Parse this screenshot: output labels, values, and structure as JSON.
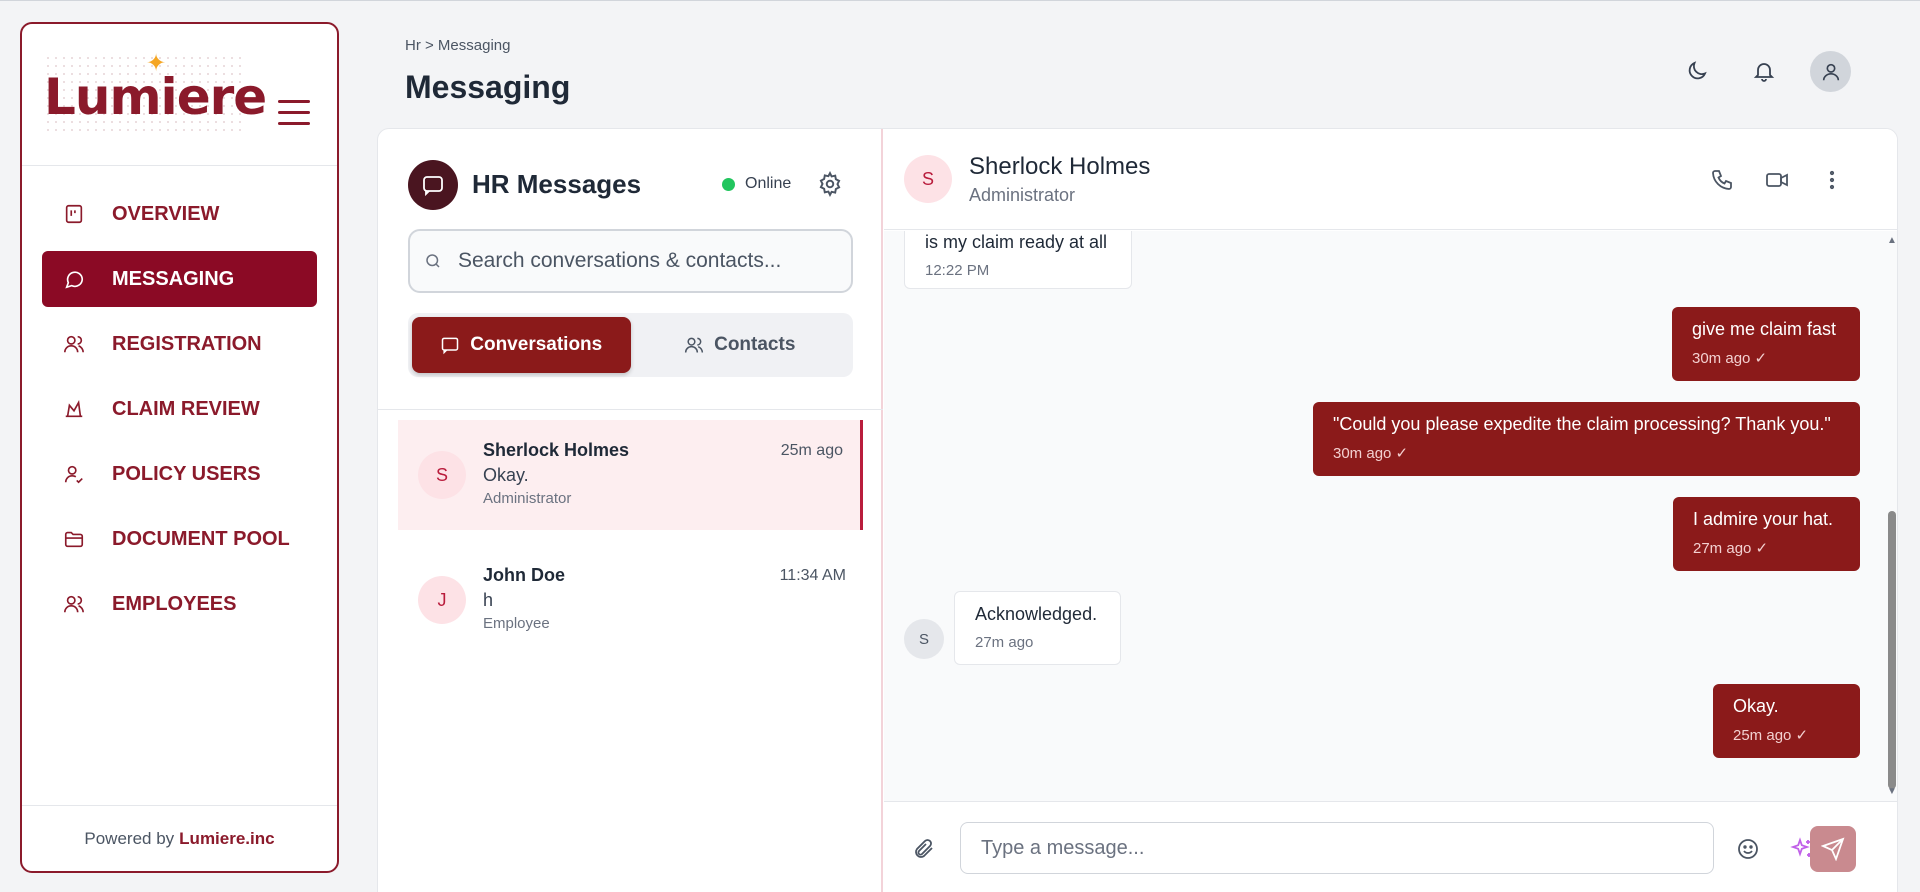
{
  "brand": {
    "name": "Lumiere",
    "powered_prefix": "Powered by",
    "powered_name": "Lumiere.inc",
    "color": "#8b1a2b"
  },
  "sidebar": {
    "items": [
      {
        "label": "OVERVIEW",
        "icon": "overview-icon",
        "active": false
      },
      {
        "label": "MESSAGING",
        "icon": "message-icon",
        "active": true
      },
      {
        "label": "REGISTRATION",
        "icon": "users-icon",
        "active": false
      },
      {
        "label": "CLAIM REVIEW",
        "icon": "claim-icon",
        "active": false
      },
      {
        "label": "POLICY USERS",
        "icon": "user-check-icon",
        "active": false
      },
      {
        "label": "DOCUMENT POOL",
        "icon": "folder-icon",
        "active": false
      },
      {
        "label": "EMPLOYEES",
        "icon": "users-icon",
        "active": false
      }
    ]
  },
  "header": {
    "breadcrumb": "Hr > Messaging",
    "title": "Messaging"
  },
  "left_panel": {
    "title": "HR Messages",
    "status": "Online",
    "search_placeholder": "Search conversations & contacts...",
    "tabs": [
      {
        "label": "Conversations",
        "active": true
      },
      {
        "label": "Contacts",
        "active": false
      }
    ],
    "conversations": [
      {
        "initial": "S",
        "name": "Sherlock Holmes",
        "time": "25m ago",
        "last_message": "Okay.",
        "role": "Administrator",
        "selected": true
      },
      {
        "initial": "J",
        "name": "John Doe",
        "time": "11:34 AM",
        "last_message": "h",
        "role": "Employee",
        "selected": false
      }
    ]
  },
  "chat": {
    "contact": {
      "initial": "S",
      "name": "Sherlock Holmes",
      "role": "Administrator"
    },
    "messages": [
      {
        "direction": "in",
        "text": "is my claim ready at all",
        "meta": "12:22 PM"
      },
      {
        "direction": "out",
        "text": "give me claim fast",
        "meta": "30m ago ✓"
      },
      {
        "direction": "out",
        "text": "\"Could you please expedite the claim processing? Thank you.\"",
        "meta": "30m ago ✓"
      },
      {
        "direction": "out",
        "text": "I admire your hat.",
        "meta": "27m ago ✓"
      },
      {
        "direction": "in",
        "text": "Acknowledged.",
        "meta": "27m ago",
        "avatar": "S"
      },
      {
        "direction": "out",
        "text": "Okay.",
        "meta": "25m ago ✓"
      }
    ],
    "input_placeholder": "Type a message..."
  }
}
